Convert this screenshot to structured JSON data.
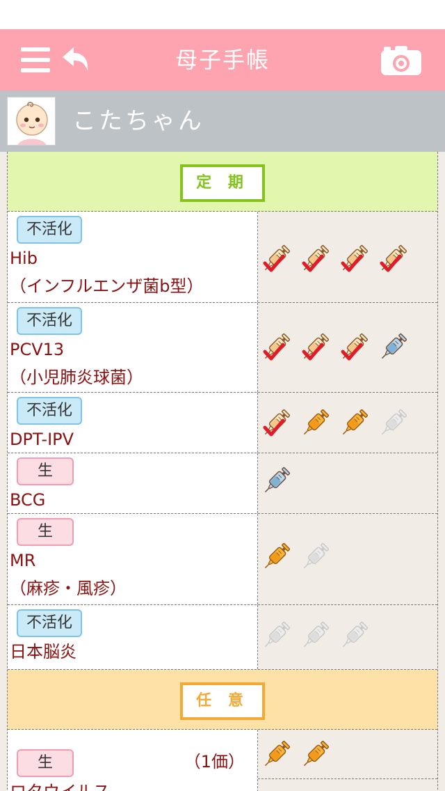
{
  "app": {
    "title": "母子手帳"
  },
  "profile": {
    "name": "こたちゃん"
  },
  "sections": {
    "teiki": "定 期",
    "nini": "任 意"
  },
  "vaccines": [
    {
      "badge": "不活化",
      "name": "Hib",
      "sub": "（インフルエンザ菌b型）",
      "doses": [
        "done",
        "done",
        "done",
        "done"
      ]
    },
    {
      "badge": "不活化",
      "name": "PCV13",
      "sub": "（小児肺炎球菌）",
      "doses": [
        "done",
        "done",
        "done",
        "blue"
      ]
    },
    {
      "badge": "不活化",
      "name": "DPT-IPV",
      "sub": "",
      "doses": [
        "done",
        "orange",
        "orange",
        "gray"
      ]
    },
    {
      "badge": "生",
      "name": "BCG",
      "sub": "",
      "doses": [
        "blue"
      ]
    },
    {
      "badge": "生",
      "name": "MR",
      "sub": "（麻疹・風疹）",
      "doses": [
        "orange",
        "gray"
      ]
    },
    {
      "badge": "不活化",
      "name": "日本脳炎",
      "sub": "",
      "doses": [
        "gray",
        "gray",
        "gray"
      ]
    },
    {
      "badge": "生",
      "name": "ロタウイルス",
      "sub": "",
      "dose_label": "（1価）",
      "doses": [
        "orange",
        "orange"
      ]
    }
  ],
  "colors": {
    "nav": "#fda4b0",
    "profile_bar": "#bdc2c6",
    "teiki": "#e1f7ad",
    "nini": "#fde1a6",
    "accent_red": "#e01c2a"
  }
}
